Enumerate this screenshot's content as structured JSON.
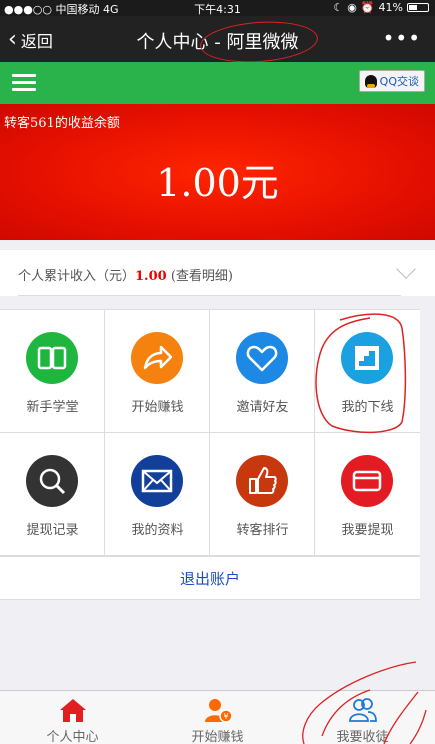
{
  "status": {
    "carrier": "●●●○○ 中国移动  4G",
    "time": "下午4:31",
    "battery": "41%"
  },
  "nav": {
    "back": "返回",
    "title": "个人中心 - 阿里微微",
    "more": "•••"
  },
  "toolbar": {
    "qq_label": "QQ交谈"
  },
  "balance": {
    "label": "转客561的收益余额",
    "amount": "1.00元"
  },
  "income": {
    "prefix": "个人累计收入（元）",
    "value": "1.00",
    "suffix": " (查看明细)"
  },
  "grid": [
    [
      {
        "label": "新手学堂",
        "icon": "book-icon",
        "color": "#1fb640"
      },
      {
        "label": "开始赚钱",
        "icon": "share-arrow-icon",
        "color": "#f5820f"
      },
      {
        "label": "邀请好友",
        "icon": "heart-icon",
        "color": "#1e88e5"
      },
      {
        "label": "我的下线",
        "icon": "stairs-icon",
        "color": "#1ba1e2"
      }
    ],
    [
      {
        "label": "提现记录",
        "icon": "magnifier-icon",
        "color": "#333333"
      },
      {
        "label": "我的资料",
        "icon": "mail-icon",
        "color": "#123f99"
      },
      {
        "label": "转客排行",
        "icon": "thumbs-up-icon",
        "color": "#c7380e"
      },
      {
        "label": "我要提现",
        "icon": "card-icon",
        "color": "#e31b23"
      }
    ]
  ],
  "logout": "退出账户",
  "tabs": [
    {
      "label": "个人中心",
      "icon": "home-icon"
    },
    {
      "label": "开始赚钱",
      "icon": "user-coin-icon"
    },
    {
      "label": "我要收徒",
      "icon": "users-icon"
    }
  ],
  "colors": {
    "nav_bg": "#222222",
    "green_bar": "#2ab34a",
    "balance_red": "#e51000",
    "accent_orange": "#ff6a00"
  }
}
